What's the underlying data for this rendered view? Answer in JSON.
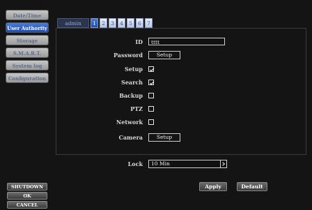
{
  "sidebar": {
    "items": [
      {
        "label": "Date/Time",
        "active": false
      },
      {
        "label": "User Authority",
        "active": true
      },
      {
        "label": "Storage",
        "active": false
      },
      {
        "label": "S.M.A.R.T.",
        "active": false
      },
      {
        "label": "System log",
        "active": false
      },
      {
        "label": "Configuration",
        "active": false
      }
    ]
  },
  "system_buttons": {
    "shutdown": "SHUTDOWN",
    "ok": "OK",
    "cancel": "CANCEL"
  },
  "tabs": {
    "user": "admin",
    "numbers": [
      "1",
      "2",
      "3",
      "4",
      "5",
      "6",
      "7"
    ],
    "active_index": 0
  },
  "form": {
    "id": {
      "label": "ID",
      "value": "tttt"
    },
    "password": {
      "label": "Password",
      "button": "Setup"
    },
    "permissions": [
      {
        "label": "Setup",
        "checked": true
      },
      {
        "label": "Search",
        "checked": true
      },
      {
        "label": "Backup",
        "checked": false
      },
      {
        "label": "PTZ",
        "checked": false
      },
      {
        "label": "Network",
        "checked": false
      }
    ],
    "camera": {
      "label": "Camera",
      "button": "Setup"
    },
    "lock": {
      "label": "Lock",
      "value": "10 Min"
    }
  },
  "actions": {
    "apply": "Apply",
    "default": "Default"
  },
  "icons": {
    "check": "check-icon",
    "dropdown": "chevron-right-icon"
  }
}
